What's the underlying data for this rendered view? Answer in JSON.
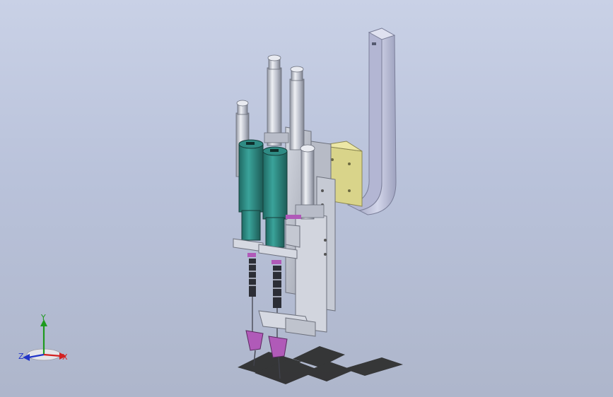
{
  "viewport": {
    "background_top": "#c9d1e6",
    "background_bottom": "#aeb6cb"
  },
  "model": {
    "colors": {
      "metal": "#c9ccd6",
      "metal_dark": "#8c909e",
      "metal_light": "#e6e8ee",
      "cylinder_body": "#2f8b84",
      "cylinder_cap": "#1e5f5a",
      "mount_plate": "#d9d48a",
      "accent_purple": "#b05ab8",
      "shadow": "#2a2a2a",
      "arm": "#c4c7e0"
    }
  },
  "triad": {
    "x_label": "X",
    "y_label": "Y",
    "z_label": "Z",
    "x_color": "#d42020",
    "y_color": "#1e9a1e",
    "z_color": "#2235c8"
  }
}
